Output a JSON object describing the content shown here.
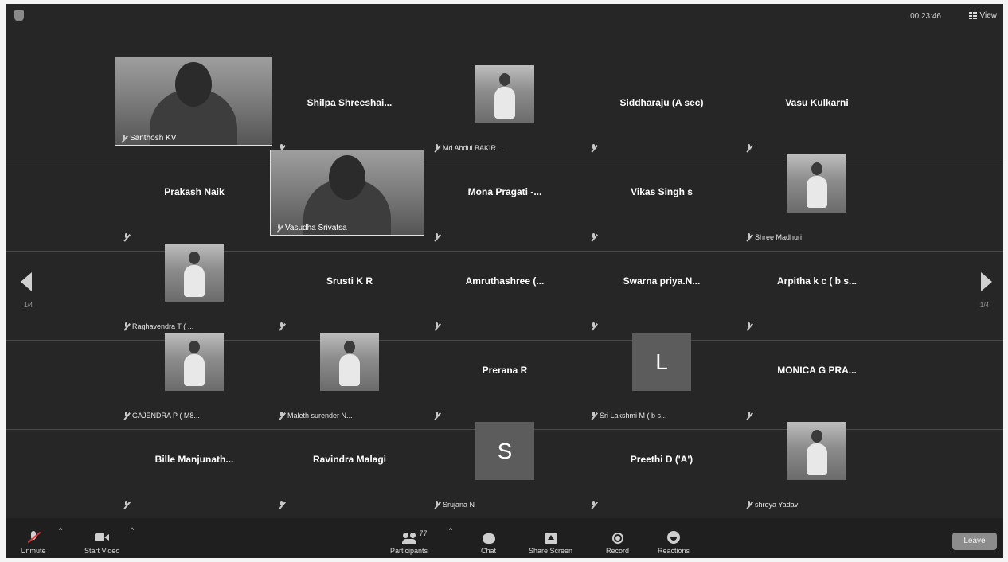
{
  "topbar": {
    "timer": "00:23:46",
    "view_label": "View",
    "security_icon": "shield-icon"
  },
  "pagination": {
    "left": "1/4",
    "right": "1/4"
  },
  "participants": [
    {
      "name": "Santhosh KV",
      "type": "video"
    },
    {
      "name": "Shilpa Shreeshai...",
      "type": "name"
    },
    {
      "name": "Md Abdul BAKIR ...",
      "type": "photo"
    },
    {
      "name": "Siddharaju (A sec)",
      "type": "name"
    },
    {
      "name": "Vasu Kulkarni",
      "type": "name"
    },
    {
      "name": "Prakash Naik",
      "type": "name"
    },
    {
      "name": "Vasudha Srivatsa",
      "type": "video"
    },
    {
      "name": "Mona Pragati -...",
      "type": "name"
    },
    {
      "name": "Vikas Singh s",
      "type": "name"
    },
    {
      "name": "Shree Madhuri",
      "type": "photo"
    },
    {
      "name": "Raghavendra T ( ...",
      "type": "photo"
    },
    {
      "name": "Srusti K R",
      "type": "name"
    },
    {
      "name": "Amruthashree (...",
      "type": "name"
    },
    {
      "name": "Swarna priya.N...",
      "type": "name"
    },
    {
      "name": "Arpitha k c ( b s...",
      "type": "name"
    },
    {
      "name": "GAJENDRA P ( M8...",
      "type": "photo"
    },
    {
      "name": "Maleth surender N...",
      "type": "photo"
    },
    {
      "name": "Prerana R",
      "type": "name"
    },
    {
      "name": "Sri Lakshmi M ( b s...",
      "type": "letter",
      "letter": "L"
    },
    {
      "name": "MONICA G PRA...",
      "type": "name"
    },
    {
      "name": "Bille Manjunath...",
      "type": "name"
    },
    {
      "name": "Ravindra Malagi",
      "type": "name"
    },
    {
      "name": "Srujana N",
      "type": "letter",
      "letter": "S"
    },
    {
      "name": "Preethi D ('A')",
      "type": "name"
    },
    {
      "name": "shreya Yadav",
      "type": "photo"
    }
  ],
  "toolbar": {
    "unmute": "Unmute",
    "start_video": "Start Video",
    "participants": "Participants",
    "participants_count": "77",
    "chat": "Chat",
    "share_screen": "Share Screen",
    "record": "Record",
    "reactions": "Reactions",
    "leave": "Leave"
  }
}
